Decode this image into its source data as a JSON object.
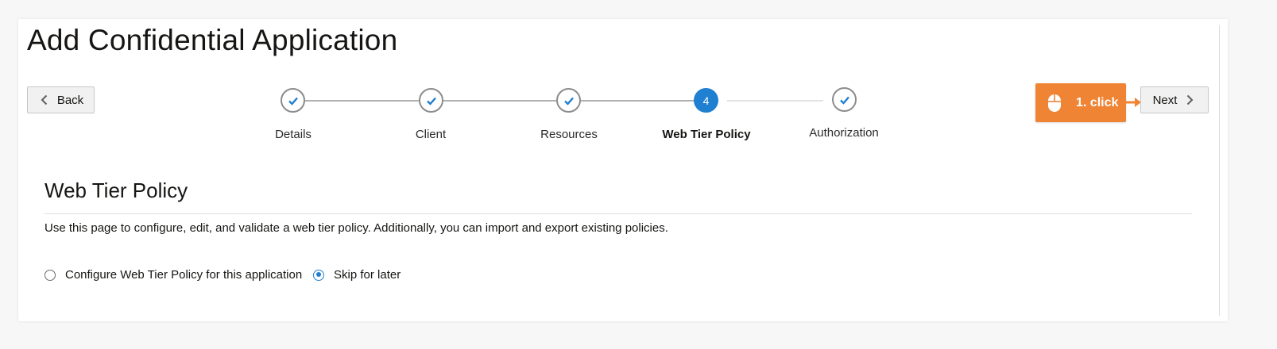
{
  "page": {
    "title": "Add Confidential Application"
  },
  "navigation": {
    "back_label": "Back",
    "next_label": "Next"
  },
  "train": {
    "steps": [
      {
        "label": "Details",
        "status": "complete"
      },
      {
        "label": "Client",
        "status": "complete"
      },
      {
        "label": "Resources",
        "status": "complete"
      },
      {
        "label": "Web Tier Policy",
        "status": "current",
        "number": "4"
      },
      {
        "label": "Authorization",
        "status": "complete"
      }
    ]
  },
  "section": {
    "title": "Web Tier Policy",
    "description": "Use this page to configure, edit, and validate a web tier policy. Additionally, you can import and export existing policies."
  },
  "options": [
    {
      "label": "Configure Web Tier Policy for this application",
      "checked": false
    },
    {
      "label": "Skip for later",
      "checked": true
    }
  ],
  "callout": {
    "label": "1. click",
    "icon": "mouse-icon"
  },
  "colors": {
    "accent": "#1f7fd1",
    "callout": "#ef8435"
  }
}
